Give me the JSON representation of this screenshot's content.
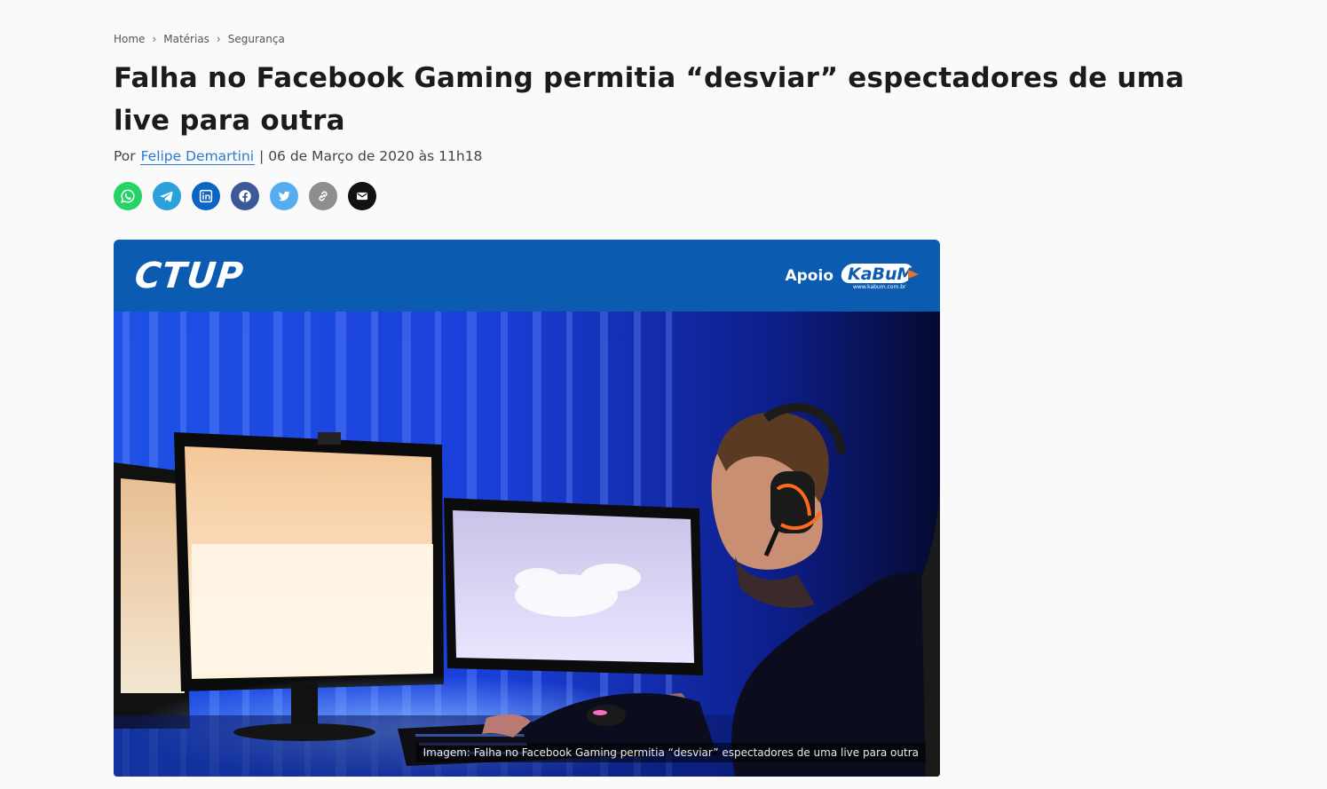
{
  "breadcrumb": {
    "items": [
      "Home",
      "Matérias",
      "Segurança"
    ],
    "separator": "›"
  },
  "article": {
    "title": "Falha no Facebook Gaming permitia “desviar” espectadores de uma live para outra",
    "byline_prefix": "Por",
    "author": "Felipe Demartini",
    "byline_divider": "|",
    "date": "06 de Março de 2020 às 11h18"
  },
  "share": [
    {
      "name": "whatsapp-icon",
      "color": "#25d366"
    },
    {
      "name": "telegram-icon",
      "color": "#2aa1da"
    },
    {
      "name": "linkedin-icon",
      "color": "#0a66c2"
    },
    {
      "name": "facebook-icon",
      "color": "#3b5998"
    },
    {
      "name": "twitter-icon",
      "color": "#55acee"
    },
    {
      "name": "link-icon",
      "color": "#8e8e8e"
    },
    {
      "name": "email-icon",
      "color": "#111111"
    }
  ],
  "banner": {
    "logo_text": "CTUP",
    "support_label": "Apoio",
    "sponsor_logo_text": "KaBuM!",
    "sponsor_url_text": "www.kabum.com.br",
    "background": "#0b5cb0"
  },
  "hero": {
    "caption": "Imagem: Falha no Facebook Gaming permitia “desviar” espectadores de uma live para outra"
  }
}
